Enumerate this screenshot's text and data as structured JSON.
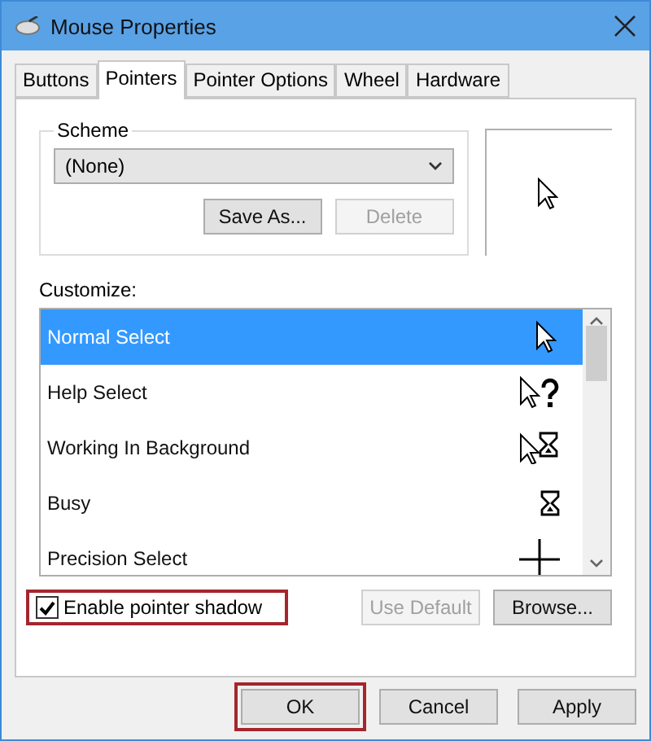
{
  "window": {
    "title": "Mouse Properties"
  },
  "tabs": [
    {
      "label": "Buttons",
      "selected": false
    },
    {
      "label": "Pointers",
      "selected": true
    },
    {
      "label": "Pointer Options",
      "selected": false
    },
    {
      "label": "Wheel",
      "selected": false
    },
    {
      "label": "Hardware",
      "selected": false
    }
  ],
  "scheme": {
    "label": "Scheme",
    "value": "(None)",
    "buttons": [
      {
        "label": "Save As...",
        "disabled": false
      },
      {
        "label": "Delete",
        "disabled": true
      }
    ]
  },
  "customize": {
    "label": "Customize:",
    "items": [
      {
        "label": "Normal Select",
        "kind": "arrow",
        "selected": true
      },
      {
        "label": "Help Select",
        "kind": "help",
        "selected": false
      },
      {
        "label": "Working In Background",
        "kind": "working",
        "selected": false
      },
      {
        "label": "Busy",
        "kind": "busy",
        "selected": false
      },
      {
        "label": "Precision Select",
        "kind": "precision",
        "selected": false
      }
    ]
  },
  "shadow": {
    "label": "Enable pointer shadow",
    "checked": true,
    "highlighted": true
  },
  "list_buttons": [
    {
      "label": "Use Default",
      "disabled": true
    },
    {
      "label": "Browse...",
      "disabled": false
    }
  ],
  "footer_buttons": [
    {
      "label": "OK",
      "highlighted": true
    },
    {
      "label": "Cancel",
      "highlighted": false
    },
    {
      "label": "Apply",
      "highlighted": false
    }
  ]
}
